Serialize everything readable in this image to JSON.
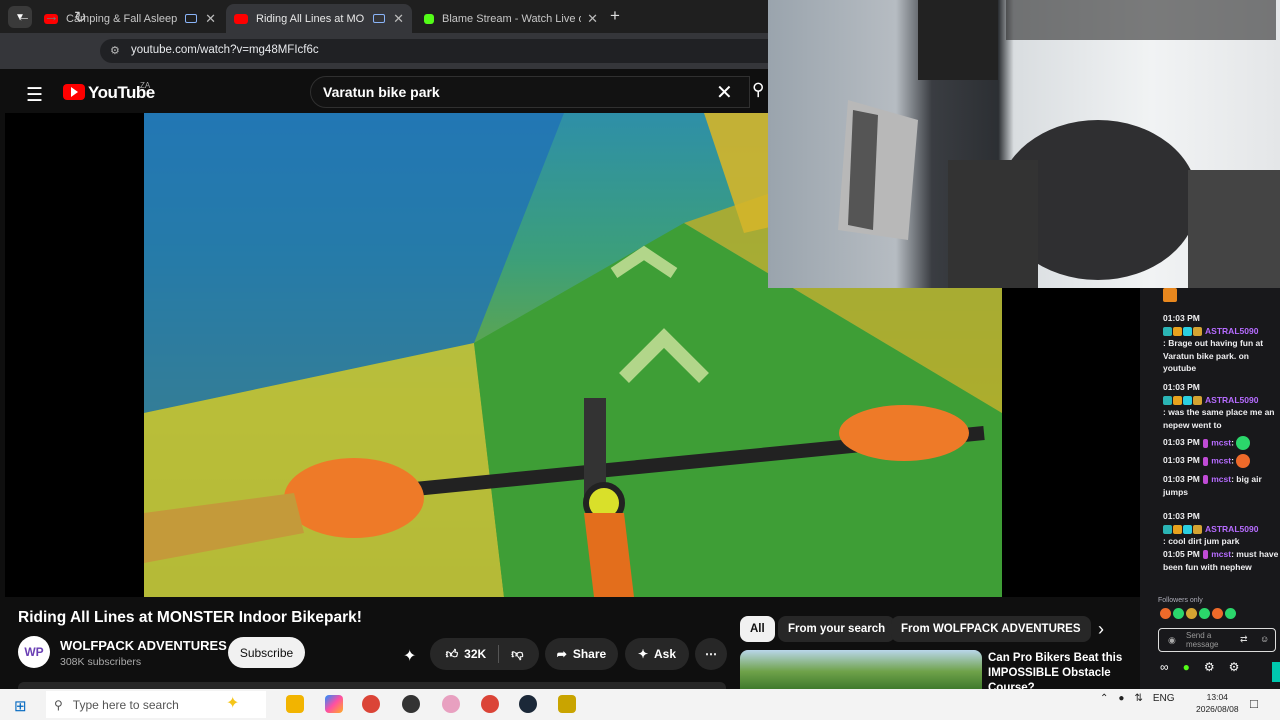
{
  "browser": {
    "tabs": [
      {
        "title": "Camping & Fall Asleep in H",
        "favicon_color": "#ff0000",
        "active": false
      },
      {
        "title": "Riding All Lines at MONSTE",
        "favicon_color": "#ff0000",
        "active": true
      },
      {
        "title": "Blame Stream - Watch Live on",
        "favicon_color": "#53fc18",
        "active": false
      }
    ],
    "new_tab": "+",
    "url": "youtube.com/watch?v=mg48MFIcf6c"
  },
  "youtube": {
    "logo_text": "YouTube",
    "country_code": "ZA",
    "search_query": "Varatun bike park",
    "video": {
      "title": "Riding All Lines at MONSTER Indoor Bikepark!",
      "channel": "WOLFPACK ADVENTURES",
      "avatar_text": "WP",
      "subscribers": "308K subscribers",
      "subscribe_label": "Subscribe",
      "likes": "32K",
      "share_label": "Share",
      "ask_label": "Ask",
      "more_label": "⋯"
    },
    "chips": [
      "All",
      "From your search",
      "From WOLFPACK ADVENTURES"
    ],
    "recommended": {
      "title": "Can Pro Bikers Beat this IMPOSSIBLE Obstacle Course?"
    }
  },
  "chat": {
    "messages": [
      {
        "time": "01:03 PM",
        "user": "ASTRAL5090",
        "text": ": Brage out having fun at Varatun bike park. on youtube"
      },
      {
        "time": "01:03 PM",
        "user": "ASTRAL5090",
        "text": ": was the same place me an nepew went to"
      },
      {
        "time": "01:03 PM",
        "user": "mcst",
        "text": ":"
      },
      {
        "time": "01:03 PM",
        "user": "mcst",
        "text": ":"
      },
      {
        "time": "01:03 PM",
        "user": "mcst",
        "text": ": big air jumps"
      },
      {
        "time": "01:03 PM",
        "user": "ASTRAL5090",
        "text": ": cool dirt jum park"
      },
      {
        "time": "01:05 PM",
        "user": "mcst",
        "text": ": must have been fun with nephew"
      }
    ],
    "followers_only": "Followers only",
    "input_placeholder": "Send a message"
  },
  "taskbar": {
    "search_placeholder": "Type here to search",
    "language": "ENG",
    "time": "13:04",
    "date": "2026/08/08"
  },
  "colors": {
    "youtube_red": "#ff0000",
    "twitch_purple": "#b66cff",
    "kick_green": "#53fc18"
  }
}
